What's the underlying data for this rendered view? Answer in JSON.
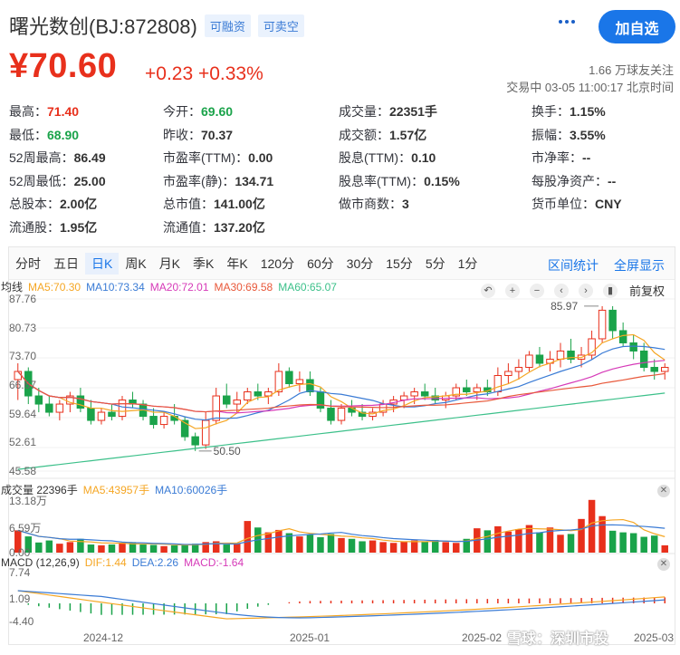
{
  "header": {
    "stock_name": "曙光数创(BJ:872808)",
    "tags": [
      "可融资",
      "可卖空"
    ],
    "add_button": "加自选"
  },
  "quote": {
    "price": "¥70.60",
    "change": "+0.23 +0.33%",
    "followers": "1.66 万球友关注",
    "status": "交易中 03-05 11:00:17 北京时间"
  },
  "stats": [
    [
      {
        "label": "最高：",
        "value": "71.40",
        "color": "red"
      },
      {
        "label": "今开：",
        "value": "69.60",
        "color": "green"
      },
      {
        "label": "成交量：",
        "value": "22351手"
      },
      {
        "label": "换手：",
        "value": "1.15%"
      }
    ],
    [
      {
        "label": "最低：",
        "value": "68.90",
        "color": "green"
      },
      {
        "label": "昨收：",
        "value": "70.37"
      },
      {
        "label": "成交额：",
        "value": "1.57亿"
      },
      {
        "label": "振幅：",
        "value": "3.55%"
      }
    ],
    [
      {
        "label": "52周最高：",
        "value": "86.49"
      },
      {
        "label": "市盈率(TTM)：",
        "value": "0.00"
      },
      {
        "label": "股息(TTM)：",
        "value": "0.10"
      },
      {
        "label": "市净率：",
        "value": "--"
      }
    ],
    [
      {
        "label": "52周最低：",
        "value": "25.00"
      },
      {
        "label": "市盈率(静)：",
        "value": "134.71"
      },
      {
        "label": "股息率(TTM)：",
        "value": "0.15%"
      },
      {
        "label": "每股净资产：",
        "value": "--"
      }
    ],
    [
      {
        "label": "总股本：",
        "value": "2.00亿"
      },
      {
        "label": "总市值：",
        "value": "141.00亿"
      },
      {
        "label": "做市商数：",
        "value": "3"
      },
      {
        "label": "货币单位：",
        "value": "CNY"
      }
    ],
    [
      {
        "label": "流通股：",
        "value": "1.95亿"
      },
      {
        "label": "流通值：",
        "value": "137.20亿"
      }
    ]
  ],
  "tabs": [
    "分时",
    "五日",
    "日K",
    "周K",
    "月K",
    "季K",
    "年K",
    "120分",
    "60分",
    "30分",
    "15分",
    "5分",
    "1分"
  ],
  "active_tab": "日K",
  "tab_links": [
    "区间统计",
    "全屏显示"
  ],
  "ma_legend": {
    "label": "均线",
    "items": [
      {
        "text": "MA5:70.30",
        "color": "#f5a623"
      },
      {
        "text": "MA10:73.34",
        "color": "#3a7bd5"
      },
      {
        "text": "MA20:72.01",
        "color": "#d63ab8"
      },
      {
        "text": "MA30:69.58",
        "color": "#e8583a"
      },
      {
        "text": "MA60:65.07",
        "color": "#3cc08a"
      }
    ]
  },
  "adjust_label": "前复权",
  "price_axis": [
    "87.76",
    "80.73",
    "73.70",
    "66.67",
    "59.64",
    "52.61",
    "45.58"
  ],
  "annotations": {
    "high": "85.97",
    "low": "50.50"
  },
  "volume_legend": {
    "label": "成交量 22396手",
    "items": [
      {
        "text": "MA5:43957手",
        "color": "#f5a623"
      },
      {
        "text": "MA10:60026手",
        "color": "#3a7bd5"
      }
    ]
  },
  "volume_axis": [
    "13.18万",
    "6.59万",
    "0.00"
  ],
  "macd_legend": {
    "label": "MACD (12,26,9)",
    "items": [
      {
        "text": "DIF:1.44",
        "color": "#f5a623"
      },
      {
        "text": "DEA:2.26",
        "color": "#3a7bd5"
      },
      {
        "text": "MACD:-1.64",
        "color": "#d63ab8"
      }
    ]
  },
  "macd_axis": [
    "7.74",
    "1.09",
    "-4.40"
  ],
  "dates": [
    "2024-12",
    "2025-01",
    "2025-02",
    "2025-03"
  ],
  "watermark": "雪球：深圳市投",
  "colors": {
    "up": "#e8301c",
    "down": "#1aa34a",
    "accent": "#1a76e8"
  },
  "chart_data": {
    "type": "candlestick",
    "candles": [
      [
        68,
        72,
        63,
        70
      ],
      [
        70,
        71,
        62,
        64
      ],
      [
        64,
        66,
        60,
        62
      ],
      [
        62,
        64,
        59,
        60
      ],
      [
        60,
        63,
        58,
        62
      ],
      [
        62,
        65,
        60,
        64
      ],
      [
        64,
        66,
        60,
        61
      ],
      [
        61,
        63,
        57,
        58
      ],
      [
        58,
        61,
        57,
        60
      ],
      [
        60,
        62,
        58,
        59
      ],
      [
        59,
        64,
        58,
        63
      ],
      [
        63,
        65,
        61,
        62
      ],
      [
        62,
        63,
        58,
        59
      ],
      [
        59,
        61,
        56,
        57
      ],
      [
        57,
        60,
        56,
        59
      ],
      [
        59,
        62,
        57,
        58
      ],
      [
        58,
        59,
        53,
        54
      ],
      [
        54,
        55,
        50.5,
        52
      ],
      [
        52,
        60,
        51,
        58
      ],
      [
        58,
        66,
        57,
        64
      ],
      [
        64,
        67,
        61,
        62
      ],
      [
        62,
        65,
        60,
        63
      ],
      [
        63,
        66,
        62,
        65
      ],
      [
        65,
        67,
        63,
        64
      ],
      [
        64,
        66,
        62,
        65
      ],
      [
        65,
        72,
        64,
        70
      ],
      [
        70,
        71,
        66,
        67
      ],
      [
        67,
        70,
        65,
        68
      ],
      [
        68,
        70,
        64,
        65
      ],
      [
        65,
        66,
        60,
        61
      ],
      [
        61,
        63,
        57,
        58
      ],
      [
        58,
        62,
        57,
        61
      ],
      [
        61,
        63,
        59,
        60
      ],
      [
        60,
        62,
        58,
        59
      ],
      [
        59,
        61,
        58,
        60
      ],
      [
        60,
        63,
        59,
        62
      ],
      [
        62,
        64,
        60,
        63
      ],
      [
        63,
        65,
        61,
        64
      ],
      [
        64,
        66,
        62,
        65
      ],
      [
        65,
        67,
        63,
        64
      ],
      [
        64,
        66,
        62,
        63
      ],
      [
        63,
        65,
        61,
        64
      ],
      [
        64,
        67,
        63,
        66
      ],
      [
        66,
        68,
        64,
        65
      ],
      [
        65,
        67,
        63,
        66
      ],
      [
        66,
        68,
        64,
        65
      ],
      [
        65,
        71,
        64,
        69
      ],
      [
        69,
        72,
        67,
        70
      ],
      [
        70,
        73,
        68,
        71
      ],
      [
        71,
        75,
        70,
        74
      ],
      [
        74,
        76,
        71,
        72
      ],
      [
        72,
        75,
        70,
        73
      ],
      [
        73,
        77,
        71,
        75
      ],
      [
        75,
        78,
        72,
        73
      ],
      [
        73,
        76,
        71,
        74
      ],
      [
        74,
        80,
        73,
        78
      ],
      [
        78,
        86,
        77,
        85
      ],
      [
        85,
        86,
        78,
        80
      ],
      [
        80,
        82,
        76,
        77
      ],
      [
        77,
        79,
        73,
        75
      ],
      [
        75,
        77,
        70,
        71
      ],
      [
        71,
        73,
        68,
        70
      ],
      [
        70,
        72,
        68,
        71
      ]
    ],
    "volumes": [
      5.5,
      4.0,
      2.5,
      3.0,
      2.2,
      2.6,
      3.4,
      2.0,
      1.8,
      2.0,
      2.4,
      2.6,
      2.0,
      1.9,
      1.6,
      1.8,
      2.1,
      2.2,
      2.6,
      2.8,
      2.0,
      2.3,
      7.8,
      6.2,
      5.0,
      5.6,
      4.8,
      4.0,
      4.4,
      3.8,
      4.6,
      3.6,
      3.4,
      2.8,
      3.0,
      2.6,
      2.4,
      2.7,
      3.0,
      2.8,
      3.1,
      2.6,
      2.4,
      3.4,
      6.0,
      5.5,
      6.5,
      5.2,
      5.8,
      6.8,
      5.0,
      6.2,
      4.4,
      4.6,
      8.3,
      13.0,
      9.0,
      5.4,
      5.0,
      4.8,
      3.9,
      4.2,
      1.8
    ]
  }
}
